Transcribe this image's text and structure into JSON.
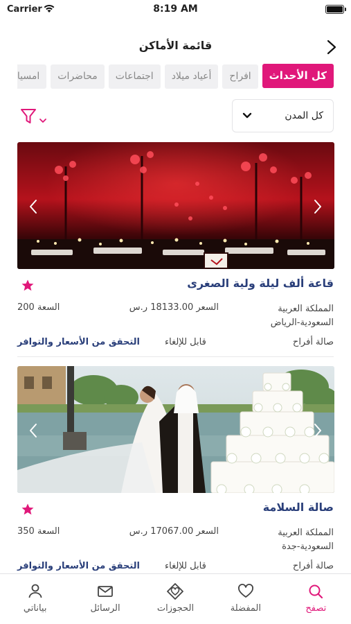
{
  "status_bar": {
    "carrier": "Carrier",
    "time": "8:19 AM"
  },
  "navbar": {
    "title": "قائمة الأماكن"
  },
  "tabs": [
    {
      "label": "كل الأحداث",
      "active": true
    },
    {
      "label": "افراح"
    },
    {
      "label": "أعياد ميلاد"
    },
    {
      "label": "اجتماعات"
    },
    {
      "label": "محاضرات"
    },
    {
      "label": "امسيات"
    }
  ],
  "city_filter": {
    "selected": "كل المدن"
  },
  "colors": {
    "accent": "#e0187a",
    "link": "#2a3f7a"
  },
  "venues": [
    {
      "name": "قاعة ألف ليلة ولية الصغرى",
      "location": "المملكة العربية السعودية-الرياض",
      "price": "السعر 18133.00 ر.س",
      "capacity": "السعة 200",
      "type": "صالة أفراح",
      "cancellation": "قابل للإلغاء",
      "check_label": "التحقق من الأسعار والتوافر"
    },
    {
      "name": "صالة السلامة",
      "location": "المملكة العربية السعودية-جدة",
      "price": "السعر 17067.00 ر.س",
      "capacity": "السعة 350",
      "type": "صالة أفراح",
      "cancellation": "قابل للإلغاء",
      "check_label": "التحقق من الأسعار والتوافر"
    }
  ],
  "tabbar": [
    {
      "label": "تصفح",
      "icon": "search-icon",
      "active": true
    },
    {
      "label": "المفضلة",
      "icon": "heart-icon"
    },
    {
      "label": "الحجوزات",
      "icon": "bookings-icon"
    },
    {
      "label": "الرسائل",
      "icon": "mail-icon"
    },
    {
      "label": "بياناتي",
      "icon": "person-icon"
    }
  ]
}
